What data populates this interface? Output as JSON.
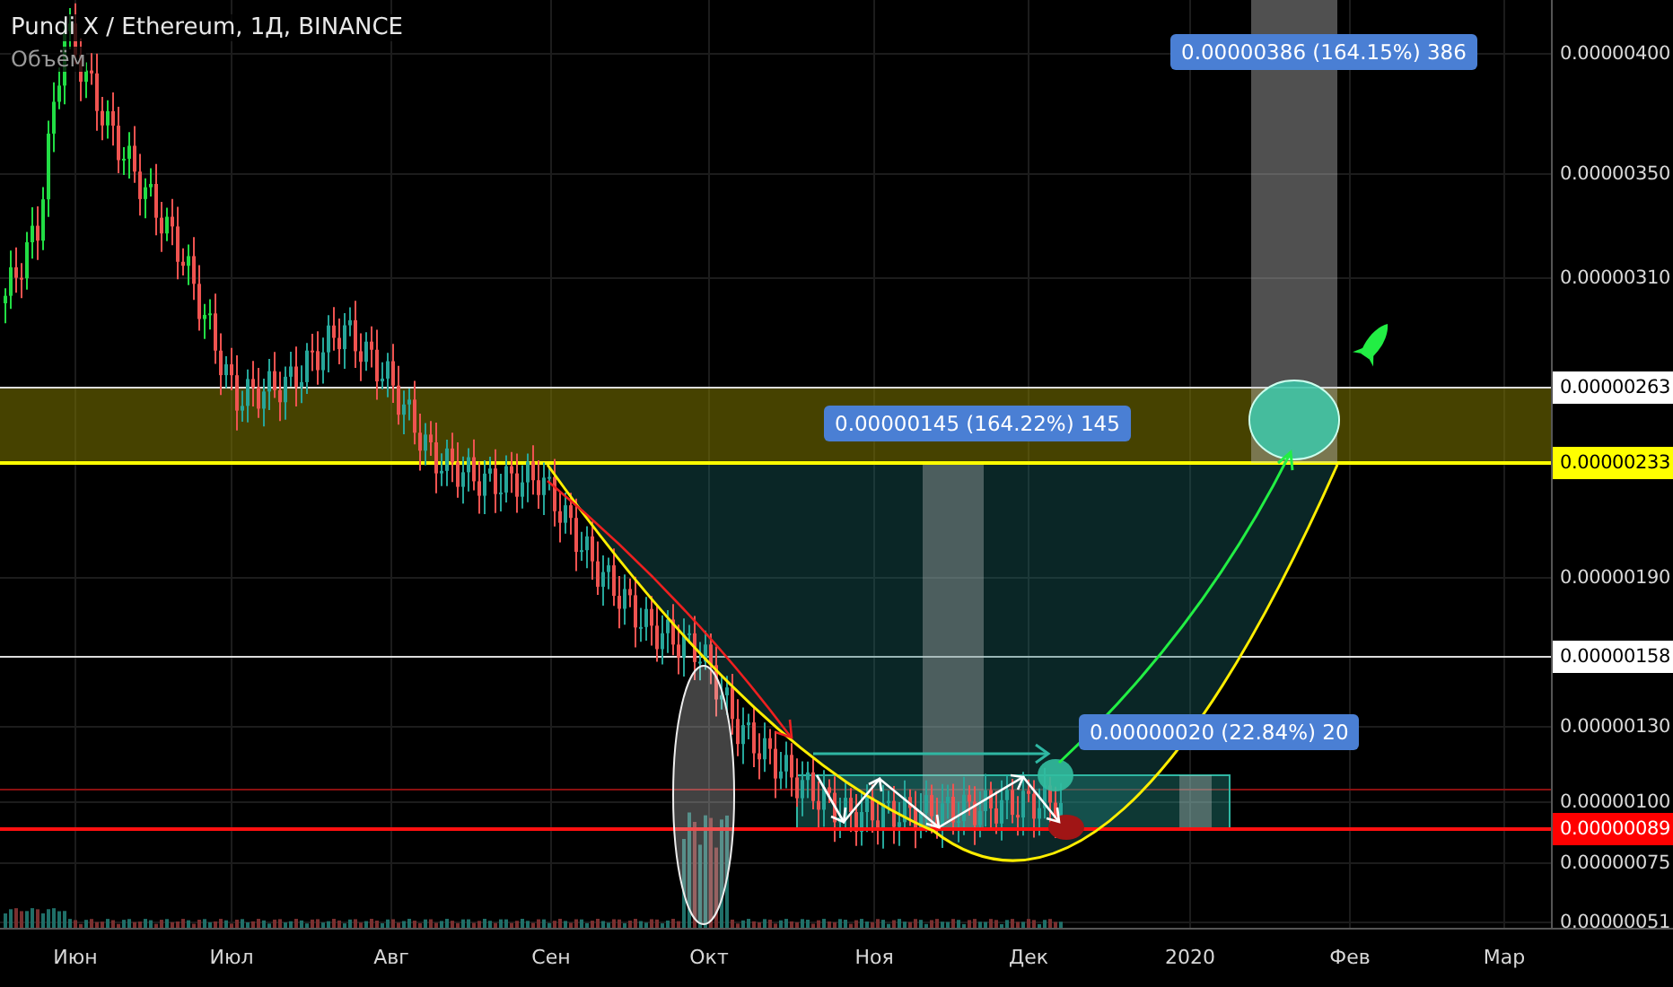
{
  "legend": {
    "title": "Pundi X / Ethereum, 1Д, BINANCE",
    "volume_label": "Объём"
  },
  "price_axis": [
    {
      "label": "0.00000400",
      "kind": "plain"
    },
    {
      "label": "0.00000350",
      "kind": "plain"
    },
    {
      "label": "0.00000310",
      "kind": "plain"
    },
    {
      "label": "0.00000263",
      "kind": "tag",
      "color": "#ffffff"
    },
    {
      "label": "0.00000233",
      "kind": "tag",
      "color": "#ffff00"
    },
    {
      "label": "0.00000190",
      "kind": "plain"
    },
    {
      "label": "0.00000158",
      "kind": "tag",
      "color": "#ffffff"
    },
    {
      "label": "0.00000130",
      "kind": "plain"
    },
    {
      "label": "0.00000100",
      "kind": "plain"
    },
    {
      "label": "0.00000089",
      "kind": "tag",
      "color": "#ff0000"
    },
    {
      "label": "0.00000075",
      "kind": "plain"
    },
    {
      "label": "0.00000051",
      "kind": "plain"
    }
  ],
  "time_axis": [
    "Июн",
    "Июл",
    "Авг",
    "Сен",
    "Окт",
    "Ноя",
    "Дек",
    "2020",
    "Фев",
    "Мар"
  ],
  "measurements": [
    {
      "label": "0.00000386 (164.15%) 386"
    },
    {
      "label": "0.00000145 (164.22%) 145"
    },
    {
      "label": "0.00000020 (22.84%) 20"
    }
  ]
}
